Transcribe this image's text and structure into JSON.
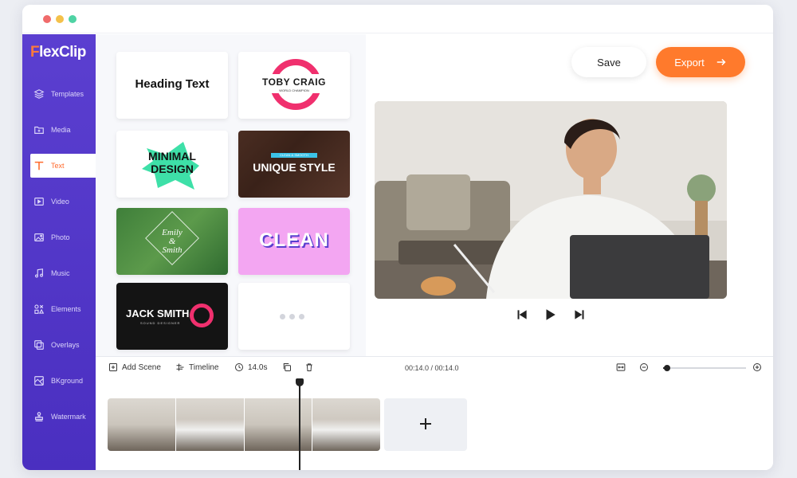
{
  "app": {
    "logo_flex": "F",
    "logo_rest": "lexClip"
  },
  "sidebar": {
    "items": [
      {
        "label": "Templates",
        "icon": "layers-icon"
      },
      {
        "label": "Media",
        "icon": "folder-plus-icon"
      },
      {
        "label": "Text",
        "icon": "text-icon",
        "active": true
      },
      {
        "label": "Video",
        "icon": "video-icon"
      },
      {
        "label": "Photo",
        "icon": "photo-icon"
      },
      {
        "label": "Music",
        "icon": "music-icon"
      },
      {
        "label": "Elements",
        "icon": "elements-icon"
      },
      {
        "label": "Overlays",
        "icon": "overlays-icon"
      },
      {
        "label": "BKground",
        "icon": "background-icon"
      },
      {
        "label": "Watermark",
        "icon": "stamp-icon"
      }
    ]
  },
  "templates": {
    "heading": "Heading Text",
    "toby": "TOBY CRAIG",
    "toby_sub": "WORLD CHAMPION",
    "minimal_1": "MINIMAL",
    "minimal_2": "DESIGN",
    "unique_tag": "CLEAN & SMOOTH",
    "unique": "UNIQUE STYLE",
    "emily_1": "Emily",
    "emily_amp": "&",
    "emily_2": "Smith",
    "clean": "CLEAN",
    "jack": "JACK SMITH",
    "jack_sub": "SOUND DESIGNER"
  },
  "actions": {
    "save": "Save",
    "export": "Export"
  },
  "timeline": {
    "add_scene": "Add Scene",
    "timeline_label": "Timeline",
    "duration": "14.0s",
    "timecode": "00:14.0 / 00:14.0",
    "zoom_level": 0.05,
    "add_plus": "+"
  },
  "colors": {
    "sidebar": "#5b3fd0",
    "accent": "#ff7a2c",
    "active_text": "#ff6a2c"
  }
}
